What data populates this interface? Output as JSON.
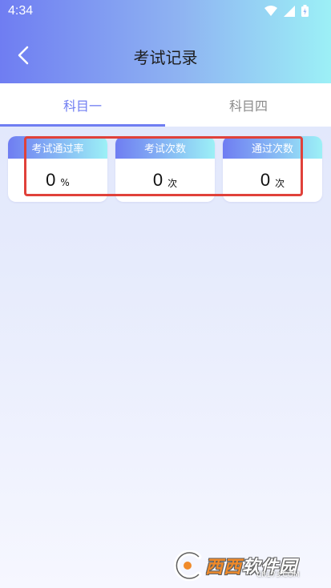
{
  "status_bar": {
    "time": "4:34",
    "icons": [
      "wifi-icon",
      "signal-icon",
      "battery-icon"
    ]
  },
  "header": {
    "title": "考试记录",
    "back_icon": "chevron-left-icon"
  },
  "tabs": [
    {
      "label": "科目一",
      "active": true
    },
    {
      "label": "科目四",
      "active": false
    }
  ],
  "stats": [
    {
      "title": "考试通过率",
      "value": "0",
      "unit": "%"
    },
    {
      "title": "考试次数",
      "value": "0",
      "unit": "次"
    },
    {
      "title": "通过次数",
      "value": "0",
      "unit": "次"
    }
  ],
  "colors": {
    "accent": "#6f7df2",
    "header_gradient_end": "#9cf0f6",
    "highlight": "#e0413a"
  },
  "watermark": {
    "brand_part1": "西西",
    "brand_part2": "软件园",
    "domain": "CR173.COM"
  }
}
